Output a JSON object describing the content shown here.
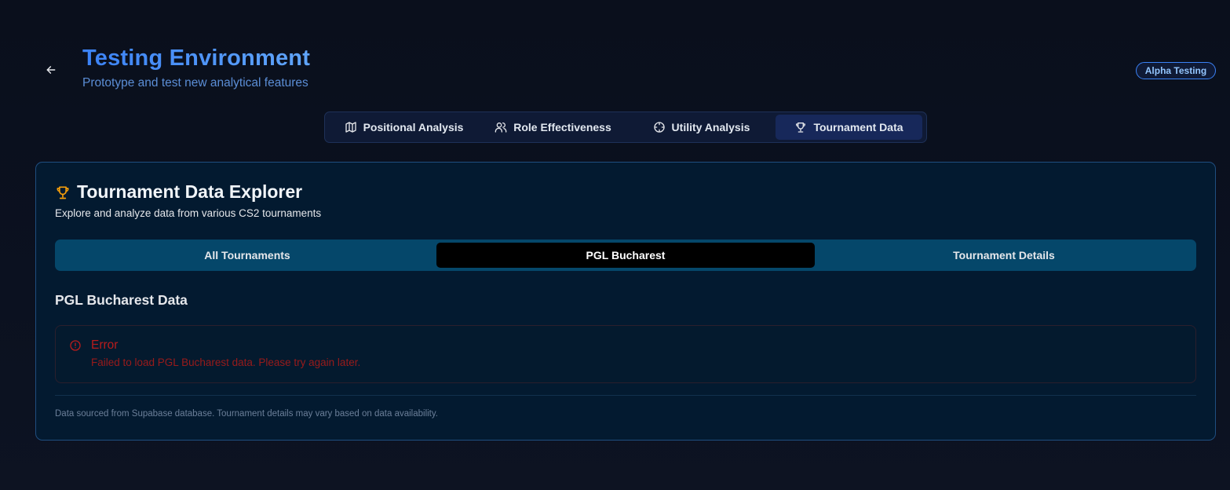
{
  "header": {
    "title": "Testing Environment",
    "subtitle": "Prototype and test new analytical features",
    "badge": "Alpha Testing",
    "back_icon": "arrow-left-icon"
  },
  "top_tabs": [
    {
      "label": "Positional Analysis",
      "icon": "map-icon"
    },
    {
      "label": "Role Effectiveness",
      "icon": "users-icon"
    },
    {
      "label": "Utility Analysis",
      "icon": "crosshair-icon"
    },
    {
      "label": "Tournament Data",
      "icon": "trophy-icon",
      "active": true
    }
  ],
  "card": {
    "title": "Tournament Data Explorer",
    "title_icon": "trophy-icon",
    "description": "Explore and analyze data from various CS2 tournaments",
    "sub_tabs": [
      {
        "label": "All Tournaments"
      },
      {
        "label": "PGL Bucharest",
        "active": true
      },
      {
        "label": "Tournament Details"
      }
    ],
    "section_title": "PGL Bucharest Data",
    "error": {
      "title": "Error",
      "message": "Failed to load PGL Bucharest data. Please try again later.",
      "icon": "alert-circle-icon"
    },
    "footnote": "Data sourced from Supabase database. Tournament details may vary based on data availability."
  },
  "colors": {
    "accent": "#3b82f6",
    "title_icon": "#f59e0b",
    "error": "#b91c1c"
  }
}
